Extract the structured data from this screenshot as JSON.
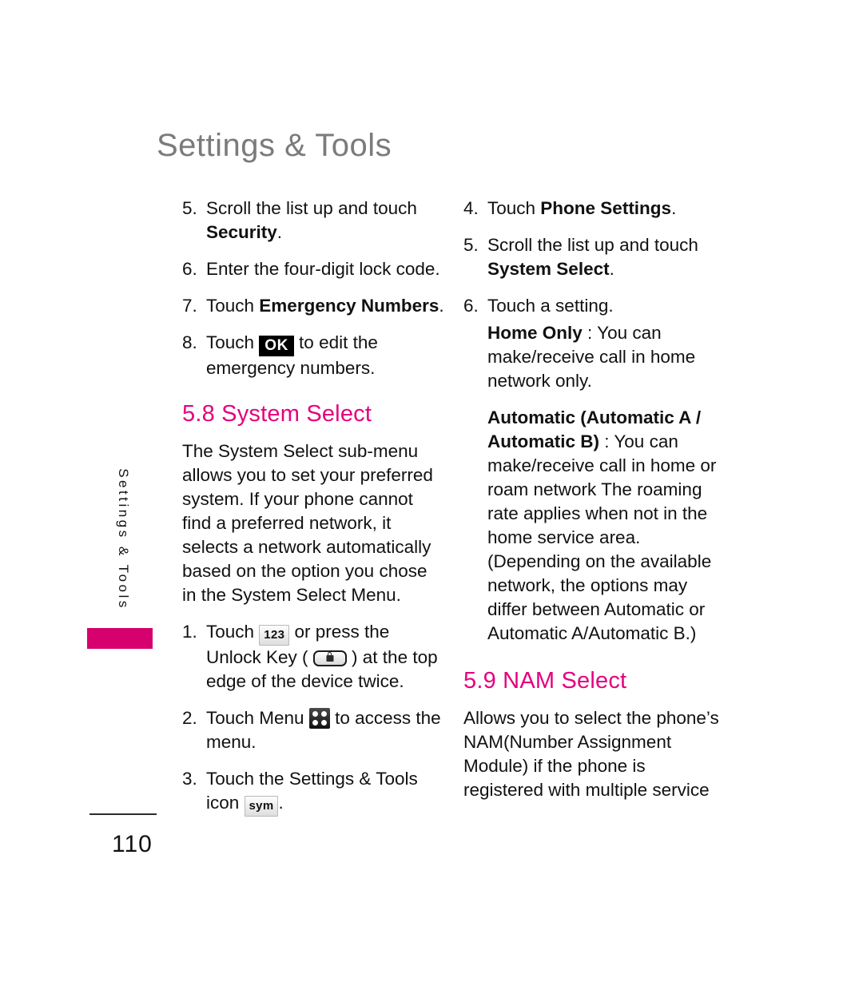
{
  "header": {
    "title": "Settings & Tools"
  },
  "side_tab": {
    "label": "Settings & Tools",
    "accent_color": "#d6006e"
  },
  "footer": {
    "page_number": "110"
  },
  "accent_color": "#e5007e",
  "icons": {
    "ok_badge": "OK",
    "numeric_key": "123",
    "symbol_key": "sym",
    "unlock_key": "unlock-key-icon",
    "menu_key": "menu-grid-icon"
  },
  "left_column": {
    "steps_continued": [
      {
        "num": "5.",
        "text_before": "Scroll the list up and touch ",
        "bold": "Security",
        "text_after": "."
      },
      {
        "num": "6.",
        "text_before": "Enter the four-digit lock code.",
        "bold": "",
        "text_after": ""
      },
      {
        "num": "7.",
        "text_before": "Touch ",
        "bold": "Emergency Numbers",
        "text_after": "."
      }
    ],
    "step8": {
      "num": "8.",
      "text_before": "Touch ",
      "badge": "OK",
      "text_after": " to edit the emergency numbers."
    },
    "section": {
      "heading": "5.8 System Select",
      "body": "The System Select sub-menu allows you to set your preferred system. If your phone cannot find a preferred network, it selects a network automatically based on the option you chose in the System Select Menu."
    },
    "steps_new": {
      "step1": {
        "num": "1.",
        "part_a": "Touch ",
        "key": "123",
        "part_b": " or press the Unlock Key ( ",
        "part_c": " ) at the top edge of the device twice."
      },
      "step2": {
        "num": "2.",
        "part_a": "Touch Menu ",
        "part_b": " to access the menu."
      },
      "step3": {
        "num": "3.",
        "part_a": "Touch the Settings & Tools icon ",
        "key": "sym",
        "part_b": "."
      }
    }
  },
  "right_column": {
    "steps": [
      {
        "num": "4.",
        "text_before": "Touch ",
        "bold": "Phone Settings",
        "text_after": "."
      },
      {
        "num": "5.",
        "text_before": "Scroll the list up and touch ",
        "bold": "System Select",
        "text_after": "."
      },
      {
        "num": "6.",
        "text_before": "Touch a setting.",
        "bold": "",
        "text_after": ""
      }
    ],
    "options": [
      {
        "term": "Home Only",
        "definition": " : You can make/receive call in home network only."
      },
      {
        "term": "Automatic (Automatic A / Automatic B)",
        "definition": " : You can make/receive call in home or roam network The roaming rate applies when not in the home service area. (Depending on the available network, the options may differ between Automatic or Automatic A/Automatic B.)"
      }
    ],
    "section": {
      "heading": "5.9 NAM Select",
      "body": "Allows you to select the phone’s NAM(Number Assignment Module) if the phone is registered with multiple service"
    }
  }
}
